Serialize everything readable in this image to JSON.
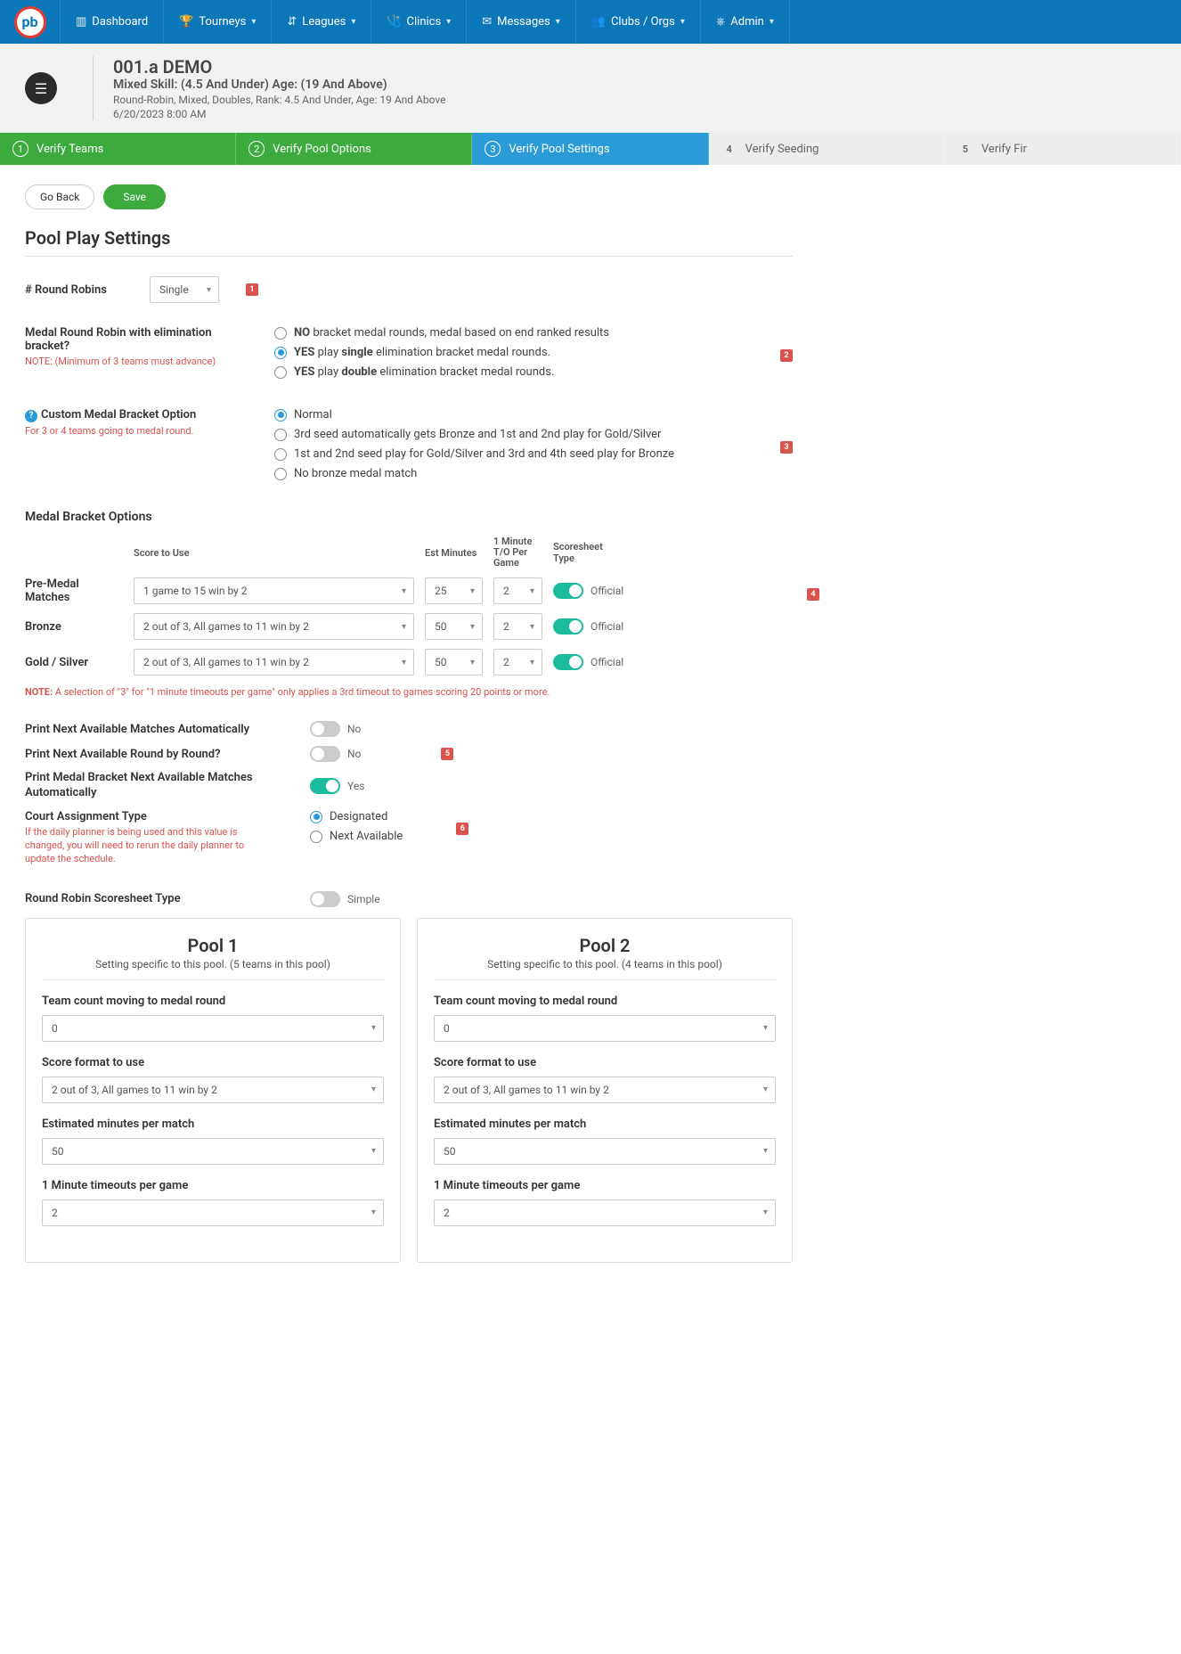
{
  "nav": {
    "items": [
      {
        "icon": "▥",
        "label": "Dashboard",
        "chev": false
      },
      {
        "icon": "🏆",
        "label": "Tourneys",
        "chev": true
      },
      {
        "icon": "⇵",
        "label": "Leagues",
        "chev": true
      },
      {
        "icon": "🩺",
        "label": "Clinics",
        "chev": true
      },
      {
        "icon": "✉",
        "label": "Messages",
        "chev": true
      },
      {
        "icon": "👥",
        "label": "Clubs / Orgs",
        "chev": true
      },
      {
        "icon": "⎈",
        "label": "Admin",
        "chev": true
      }
    ]
  },
  "header": {
    "title": "001.a DEMO",
    "subtitle": "Mixed Skill: (4.5 And Under) Age: (19 And Above)",
    "meta1": "Round-Robin, Mixed, Doubles, Rank: 4.5 And Under, Age: 19 And Above",
    "meta2": "6/20/2023 8:00 AM"
  },
  "steps": [
    {
      "num": "1",
      "label": "Verify Teams",
      "state": "done"
    },
    {
      "num": "2",
      "label": "Verify Pool Options",
      "state": "done"
    },
    {
      "num": "3",
      "label": "Verify Pool Settings",
      "state": "active"
    },
    {
      "num": "4",
      "label": "Verify Seeding",
      "state": "pending"
    },
    {
      "num": "5",
      "label": "Verify Fir",
      "state": "pending"
    }
  ],
  "buttons": {
    "back": "Go Back",
    "save": "Save"
  },
  "section_title": "Pool Play Settings",
  "markers": {
    "m1": "1",
    "m2": "2",
    "m3": "3",
    "m4": "4",
    "m5": "5",
    "m6": "6"
  },
  "round_robins": {
    "label": "# Round Robins",
    "value": "Single"
  },
  "medal_rr": {
    "label": "Medal Round Robin with elimination bracket?",
    "help": "NOTE: (Minimum of 3 teams must advance)",
    "opts": {
      "no_pre": "NO",
      "no_rest": " bracket medal rounds, medal based on end ranked results",
      "yes1a": "YES",
      "yes1b": " play ",
      "yes1c": "single",
      "yes1d": " elimination bracket medal rounds.",
      "yes2a": "YES",
      "yes2b": " play ",
      "yes2c": "double",
      "yes2d": " elimination bracket medal rounds."
    }
  },
  "custom_bracket": {
    "label": "Custom Medal Bracket Option",
    "help": "For 3 or 4 teams going to medal round.",
    "opts": {
      "o1": "Normal",
      "o2": "3rd seed automatically gets Bronze and 1st and 2nd play for Gold/Silver",
      "o3": "1st and 2nd seed play for Gold/Silver and 3rd and 4th seed play for Bronze",
      "o4": "No bronze medal match"
    }
  },
  "mbo": {
    "title": "Medal Bracket Options",
    "headers": {
      "score": "Score to Use",
      "est": "Est Minutes",
      "to": "1 Minute T/O Per Game",
      "sheet": "Scoresheet Type"
    },
    "rows": [
      {
        "label": "Pre-Medal Matches",
        "score": "1 game to 15 win by 2",
        "est": "25",
        "to": "2",
        "sheet": "Official"
      },
      {
        "label": "Bronze",
        "score": "2 out of 3, All games to 11 win by 2",
        "est": "50",
        "to": "2",
        "sheet": "Official"
      },
      {
        "label": "Gold / Silver",
        "score": "2 out of 3, All games to 11 win by 2",
        "est": "50",
        "to": "2",
        "sheet": "Official"
      }
    ],
    "note_pre": "NOTE:",
    "note": " A selection of \"3\" for \"1 minute timeouts per game\" only applies a 3rd timeout to games scoring 20 points or more."
  },
  "prints": {
    "p1": {
      "label": "Print Next Available Matches Automatically",
      "val": "No",
      "on": false
    },
    "p2": {
      "label": "Print Next Available Round by Round?",
      "val": "No",
      "on": false
    },
    "p3": {
      "label": "Print Medal Bracket Next Available Matches Automatically",
      "val": "Yes",
      "on": true
    }
  },
  "court": {
    "label": "Court Assignment Type",
    "help": "If the daily planner is being used and this value is changed, you will need to rerun the daily planner to update the schedule.",
    "opts": {
      "o1": "Designated",
      "o2": "Next Available"
    }
  },
  "rr_sheet": {
    "label": "Round Robin Scoresheet Type",
    "val": "Simple",
    "on": false
  },
  "pools": [
    {
      "title": "Pool 1",
      "sub": "Setting specific to this pool. (5 teams in this pool)",
      "f1_label": "Team count moving to medal round",
      "f1": "0",
      "f2_label": "Score format to use",
      "f2": "2 out of 3, All games to 11 win by 2",
      "f3_label": "Estimated minutes per match",
      "f3": "50",
      "f4_label": "1 Minute timeouts per game",
      "f4": "2"
    },
    {
      "title": "Pool 2",
      "sub": "Setting specific to this pool. (4 teams in this pool)",
      "f1_label": "Team count moving to medal round",
      "f1": "0",
      "f2_label": "Score format to use",
      "f2": "2 out of 3, All games to 11 win by 2",
      "f3_label": "Estimated minutes per match",
      "f3": "50",
      "f4_label": "1 Minute timeouts per game",
      "f4": "2"
    }
  ]
}
